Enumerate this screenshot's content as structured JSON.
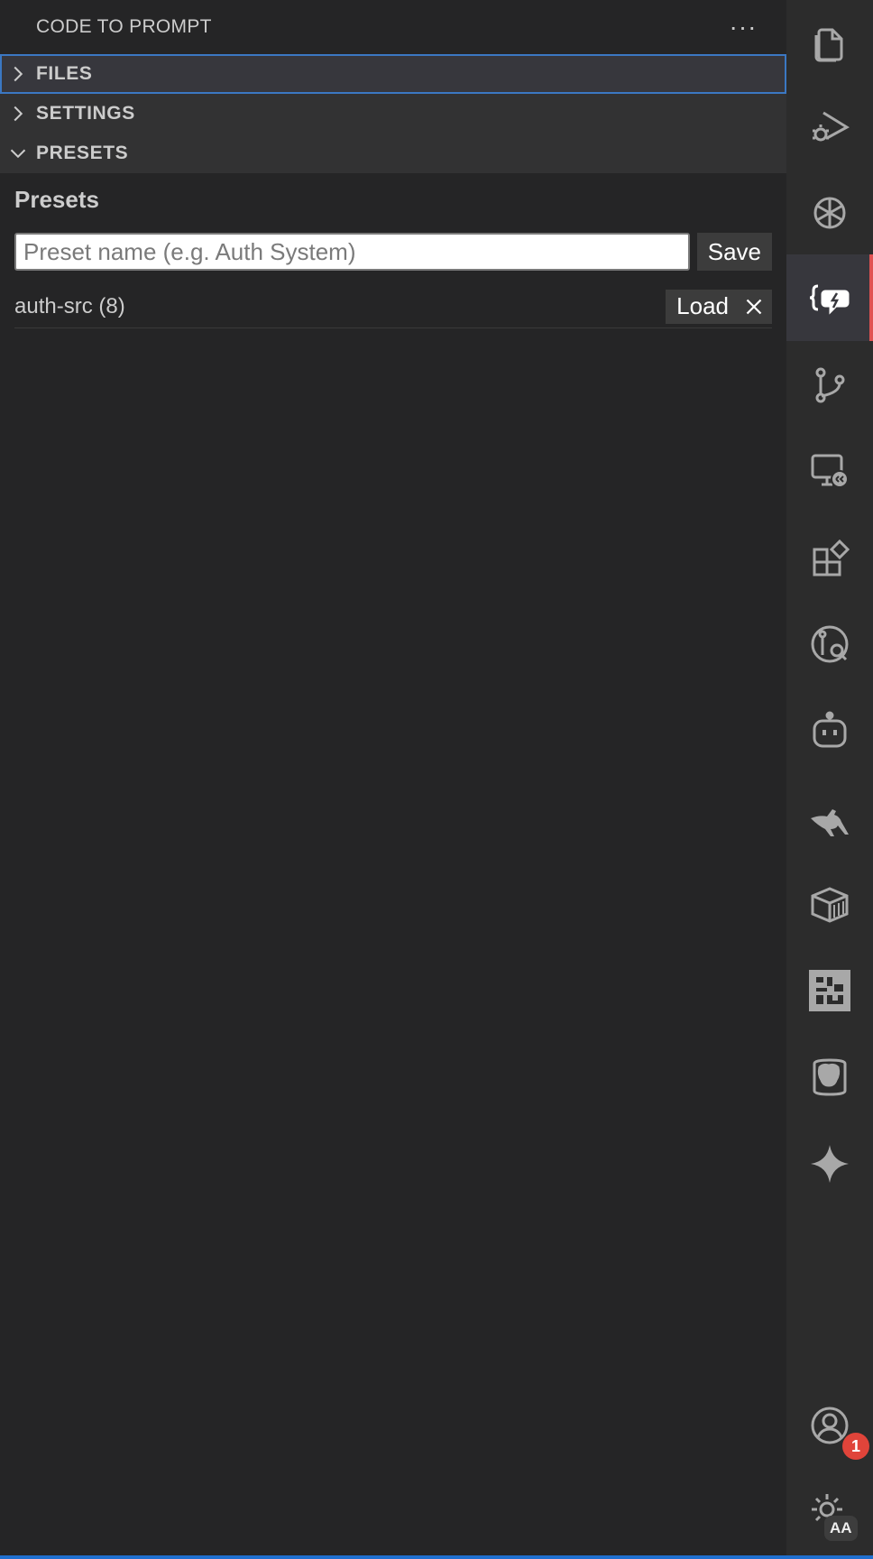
{
  "sidebar": {
    "title": "CODE TO PROMPT",
    "more_label": "···",
    "sections": [
      {
        "label": "FILES",
        "expanded": false
      },
      {
        "label": "SETTINGS",
        "expanded": false
      },
      {
        "label": "PRESETS",
        "expanded": true
      }
    ]
  },
  "presets": {
    "heading": "Presets",
    "input_placeholder": "Preset name (e.g. Auth System)",
    "input_value": "",
    "save_label": "Save",
    "items": [
      {
        "name": "auth-src (8)",
        "load_label": "Load"
      }
    ]
  },
  "activity_bar": {
    "items": [
      {
        "icon": "files-icon"
      },
      {
        "icon": "run-debug-icon"
      },
      {
        "icon": "openai-icon"
      },
      {
        "icon": "code-to-prompt-icon",
        "active": true
      },
      {
        "icon": "source-control-icon"
      },
      {
        "icon": "remote-explorer-icon"
      },
      {
        "icon": "extensions-icon"
      },
      {
        "icon": "git-lens-icon"
      },
      {
        "icon": "copilot-icon"
      },
      {
        "icon": "kangaroo-icon"
      },
      {
        "icon": "container-icon"
      },
      {
        "icon": "qr-code-icon"
      },
      {
        "icon": "postgres-icon"
      },
      {
        "icon": "sparkle-icon"
      }
    ],
    "accounts_badge": "1",
    "settings_badge": "AA"
  },
  "colors": {
    "accent_active": "#e05252",
    "focus_border": "#3b78c3",
    "badge": "#e0443a"
  }
}
